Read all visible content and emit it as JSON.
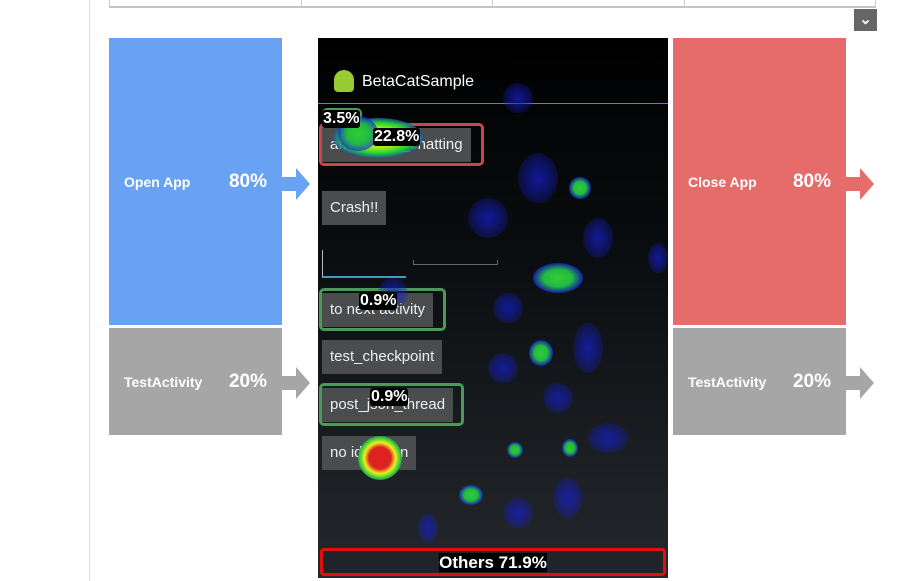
{
  "toolbar": {
    "expand_icon": "chevron-down-icon"
  },
  "entry": [
    {
      "label": "Open App",
      "percent": "80%",
      "color": "#6aa2f3"
    },
    {
      "label": "TestActivity",
      "percent": "20%",
      "color": "#a6a6a6"
    }
  ],
  "exit": [
    {
      "label": "Close App",
      "percent": "80%",
      "color": "#e66b6b"
    },
    {
      "label": "TestActivity",
      "percent": "20%",
      "color": "#a6a6a6"
    }
  ],
  "screen": {
    "app_title": "BetaCatSample",
    "buttons": [
      "after_open_chatting",
      "Crash!!",
      "to next activity",
      "test_checkpoint",
      "post_json_thread",
      "no id button"
    ],
    "percent_labels": {
      "home": "3.5%",
      "after_open_chatting": "22.8%",
      "to_next_activity": "0.9%",
      "post_json_thread": "0.9%"
    },
    "others": "Others 71.9%",
    "highlight_colors": {
      "high": "#c84848",
      "low": "#4a9a5a",
      "others": "#e01010"
    }
  }
}
